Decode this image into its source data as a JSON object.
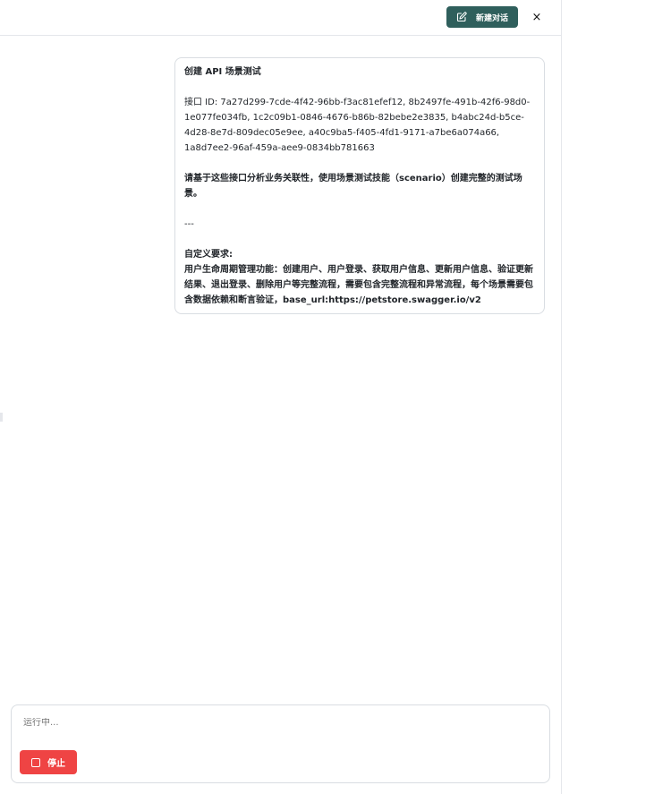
{
  "header": {
    "new_chat_label": "新建对话",
    "close_glyph": "×",
    "new_chat_icon": "edit-icon",
    "accent": "#2f5f5c"
  },
  "message": {
    "title": "创建 API 场景测试",
    "ids_line": "接口 ID: 7a27d299-7cde-4f42-96bb-f3ac81efef12, 8b2497fe-491b-42f6-98d0-1e077fe034fb, 1c2c09b1-0846-4676-b86b-82bebe2e3835, b4abc24d-b5ce-4d28-8e7d-809dec05e9ee, a40c9ba5-f405-4fd1-9171-a7be6a074a66, 1a8d7ee2-96af-459a-aee9-0834bb781663",
    "instruction": "请基于这些接口分析业务关联性，使用场景测试技能（scenario）创建完整的测试场景。",
    "separator": "---",
    "custom_label": "自定义要求:",
    "custom_body": "用户生命周期管理功能：创建用户、用户登录、获取用户信息、更新用户信息、验证更新结果、退出登录、删除用户等完整流程，需要包含完整流程和异常流程，每个场景需要包含数据依赖和断言验证，base_url:https://petstore.swagger.io/v2"
  },
  "composer": {
    "status_text": "运行中...",
    "stop_label": "停止",
    "stop_icon": "stop-square-icon",
    "stop_color": "#ef4444"
  }
}
